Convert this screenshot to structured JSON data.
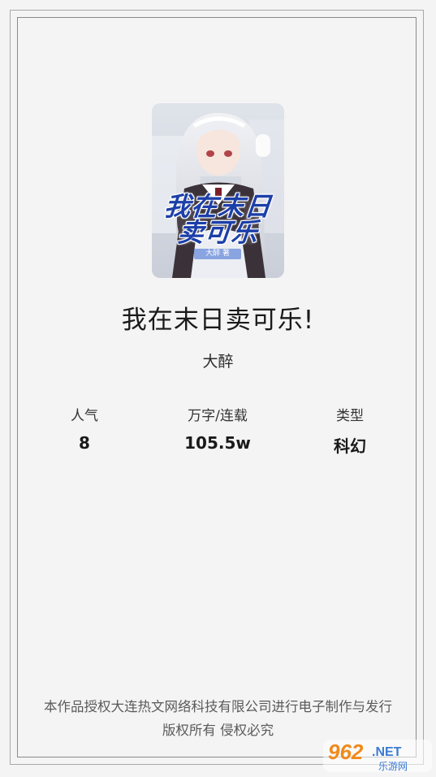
{
  "book": {
    "cover_title_line1": "我在末日",
    "cover_title_line2": "卖可乐",
    "cover_author_tag": "大醉 著",
    "title": "我在末日卖可乐!",
    "author": "大醉"
  },
  "stats": [
    {
      "label": "人气",
      "value": "8"
    },
    {
      "label": "万字/连载",
      "value": "105.5w"
    },
    {
      "label": "类型",
      "value": "科幻"
    }
  ],
  "footer": {
    "line1": "本作品授权大连热文网络科技有限公司进行电子制作与发行",
    "line2": "版权所有 侵权必究"
  },
  "watermark": {
    "brand": "962",
    "suffix": ".NET",
    "subtitle": "乐游网"
  },
  "colors": {
    "background": "#f4f4f4",
    "cover_title": "#1c3fa8",
    "watermark_orange": "#f08a1c"
  }
}
